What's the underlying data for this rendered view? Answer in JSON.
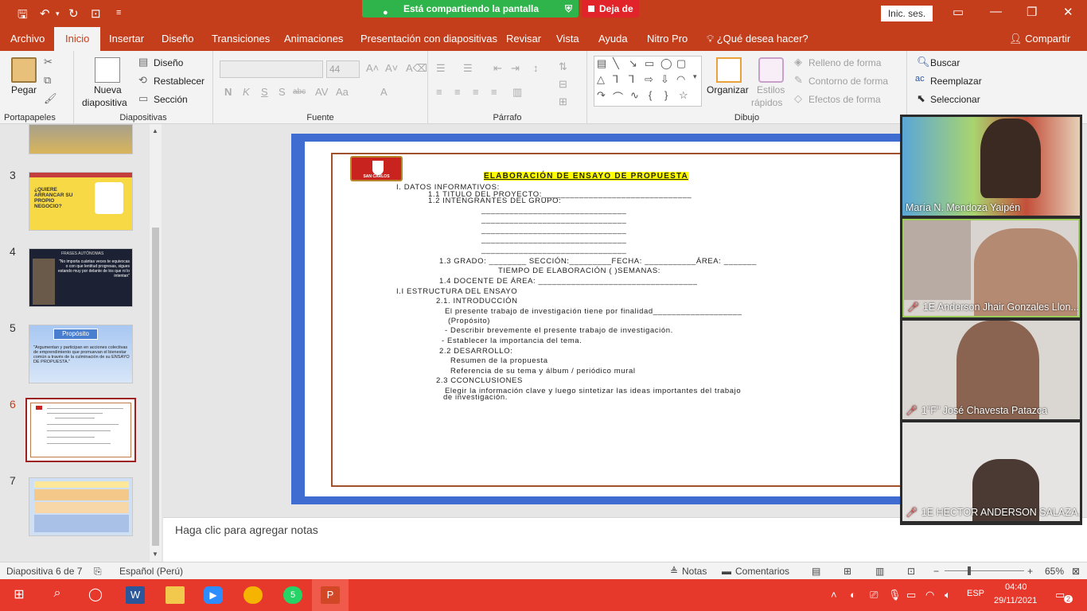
{
  "title_bar": {
    "sharing_text": "Está compartiendo la pantalla",
    "stop_sharing": "Deja de",
    "sign_in": "Inic. ses."
  },
  "tabs": [
    "Archivo",
    "Inicio",
    "Insertar",
    "Diseño",
    "Transiciones",
    "Animaciones",
    "Presentación con diapositivas",
    "Revisar",
    "Vista",
    "Ayuda",
    "Nitro Pro"
  ],
  "tell_me": "¿Qué desea hacer?",
  "share": "Compartir",
  "ribbon": {
    "paste": "Pegar",
    "clipboard_group": "Portapapeles",
    "new_slide_line1": "Nueva",
    "new_slide_line2": "diapositiva",
    "layout": "Diseño",
    "reset": "Restablecer",
    "section": "Sección",
    "slides_group": "Diapositivas",
    "font_size": "44",
    "font_group": "Fuente",
    "paragraph_group": "Párrafo",
    "arrange": "Organizar",
    "quick_styles_line1": "Estilos",
    "quick_styles_line2": "rápidos",
    "shape_fill": "Relleno de forma",
    "shape_outline": "Contorno de forma",
    "shape_effects": "Efectos de forma",
    "drawing_group": "Dibujo",
    "find": "Buscar",
    "replace": "Reemplazar",
    "select": "Seleccionar"
  },
  "thumbnails": [
    {
      "num": "3",
      "title": "¿QUIERE ARRANCAR SU PROPIO NEGOCIO?",
      "color": "#f6d945"
    },
    {
      "num": "4",
      "title": "FRASES AUTÓNOMAS",
      "quote": "\"No importa cuántas veces te equivocas o con que lentitud progresas, sigues estando muy por delante de los que ni lo intentan\""
    },
    {
      "num": "5",
      "title": "Propósito",
      "text": "\"Argumentan y participan en acciones colectivas de emprendimiento que promuevan el bienestar común a través de la culminación de su ENSAYO DE PROPUESTA.\""
    },
    {
      "num": "6"
    },
    {
      "num": "7"
    }
  ],
  "slide": {
    "title": "ELABORACIÓN DE ENSAYO DE PROPUESTA",
    "logo_text": "SAN CARLOS",
    "lines": [
      "I.        DATOS INFORMATIVOS:",
      "1.1      TITULO DEL PROYECTO:________________________________",
      "1.2      INTENGRANTES DEL GRUPO:",
      "_______________________________",
      "_______________________________",
      "_______________________________",
      "_______________________________",
      "_______________________________",
      "1.3     GRADO: ________   SECCIÓN:_________FECHA: ___________ÁREA: _______",
      "TIEMPO DE ELABORACIÓN (     )SEMANAS:",
      "1.4     DOCENTE DE ÁREA: __________________________________",
      "I.I          ESTRUCTURA DEL ENSAYO",
      "2.1. INTRODUCCIÓN",
      "El presente trabajo de investigación tiene por finalidad___________________",
      "(Propósito)",
      "- Describir brevemente el presente trabajo de investigación.",
      "- Establecer la importancia del tema.",
      "2.2 DESARROLLO:",
      "Resumen de la propuesta",
      "Referencia de su tema y álbum / periódico mural",
      "2.3 CCONCLUSIONES",
      "Elegir la información clave y luego sintetizar las ideas importantes del trabajo",
      "de investigación."
    ]
  },
  "notes_placeholder": "Haga clic para agregar notas",
  "participants": [
    {
      "name": "María N. Mendoza Yaipén",
      "muted": false
    },
    {
      "name": "1E Anderson Jhair Gonzales Llon...",
      "muted": true
    },
    {
      "name": "1\"F\" José Chavesta Patazca",
      "muted": true
    },
    {
      "name": "1E HECTOR ANDERSON SALAZA...",
      "muted": true
    }
  ],
  "status": {
    "slide_info": "Diapositiva 6 de 7",
    "language": "Español (Perú)",
    "notes": "Notas",
    "comments": "Comentarios",
    "zoom": "65%"
  },
  "taskbar": {
    "whatsapp_badge": "5",
    "lang": "ESP",
    "time": "04:40",
    "date": "29/11/2021",
    "notif_count": "2"
  }
}
